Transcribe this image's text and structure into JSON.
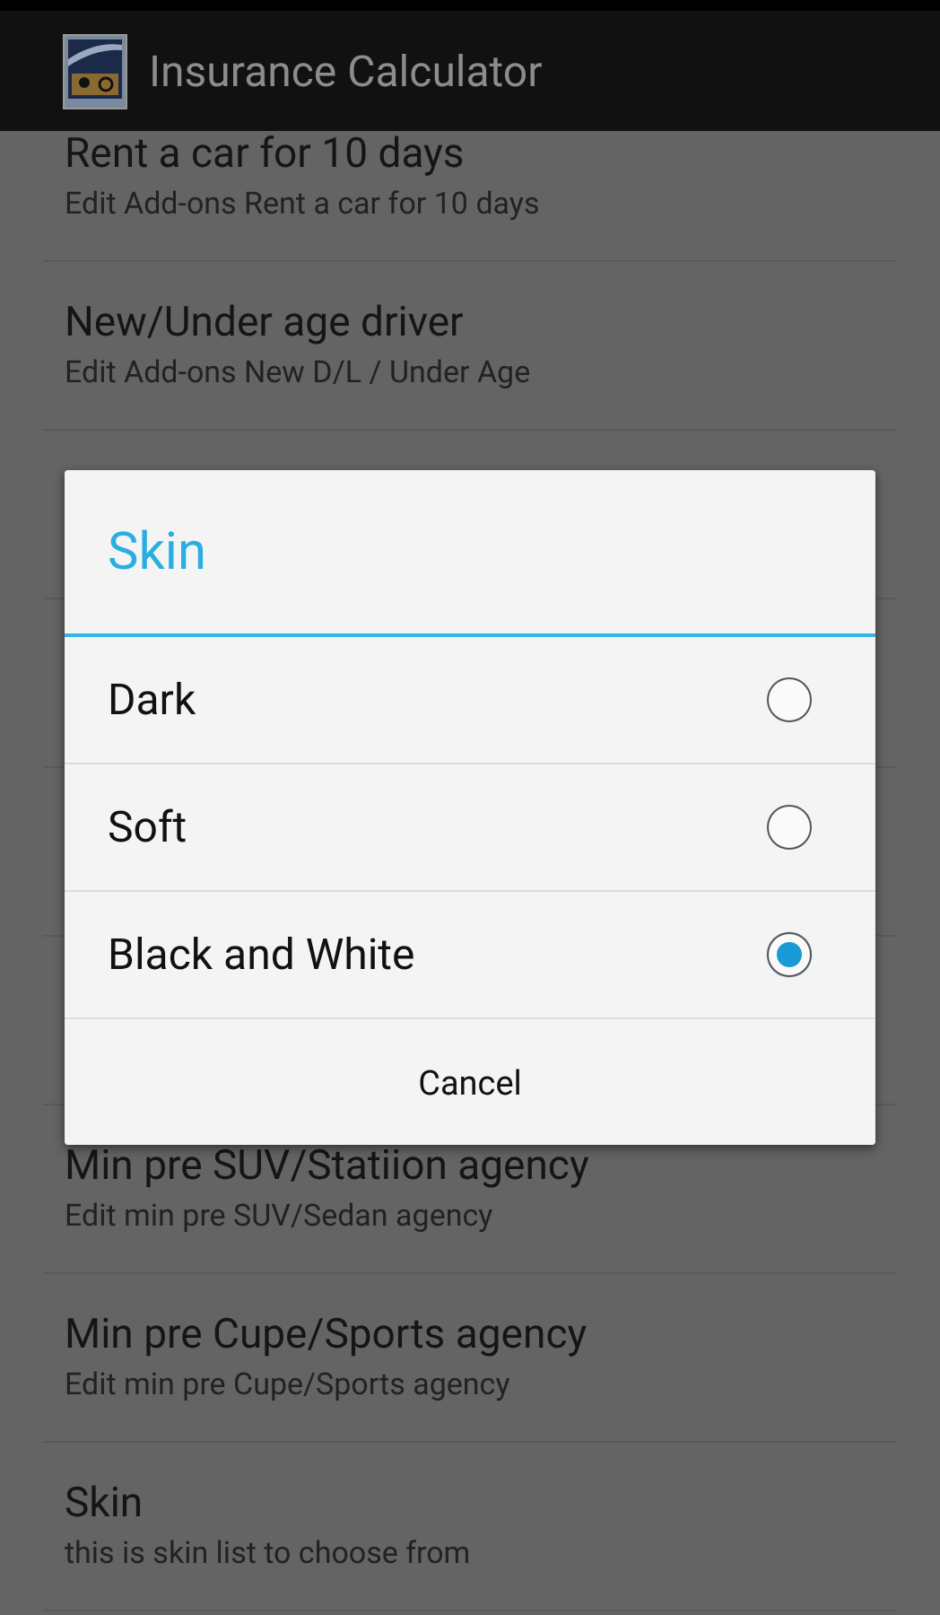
{
  "app_bar": {
    "title": "Insurance Calculator"
  },
  "settings_above_dialog": [
    {
      "title": "Rent a car for 10 days",
      "summary": "Edit Add-ons Rent a car for 10 days"
    },
    {
      "title": "New/Under age driver",
      "summary": "Edit Add-ons New D/L / Under Age"
    }
  ],
  "settings_below_dialog": [
    {
      "title": "Min pre SUV/Statiion agency",
      "summary": "Edit min pre SUV/Sedan agency"
    },
    {
      "title": "Min pre Cupe/Sports agency",
      "summary": "Edit min pre Cupe/Sports agency"
    },
    {
      "title": "Skin",
      "summary": "this is skin list to choose from"
    }
  ],
  "dialog": {
    "title": "Skin",
    "options": [
      {
        "label": "Dark",
        "selected": false
      },
      {
        "label": "Soft",
        "selected": false
      },
      {
        "label": "Black and White",
        "selected": true
      }
    ],
    "button": "Cancel"
  }
}
